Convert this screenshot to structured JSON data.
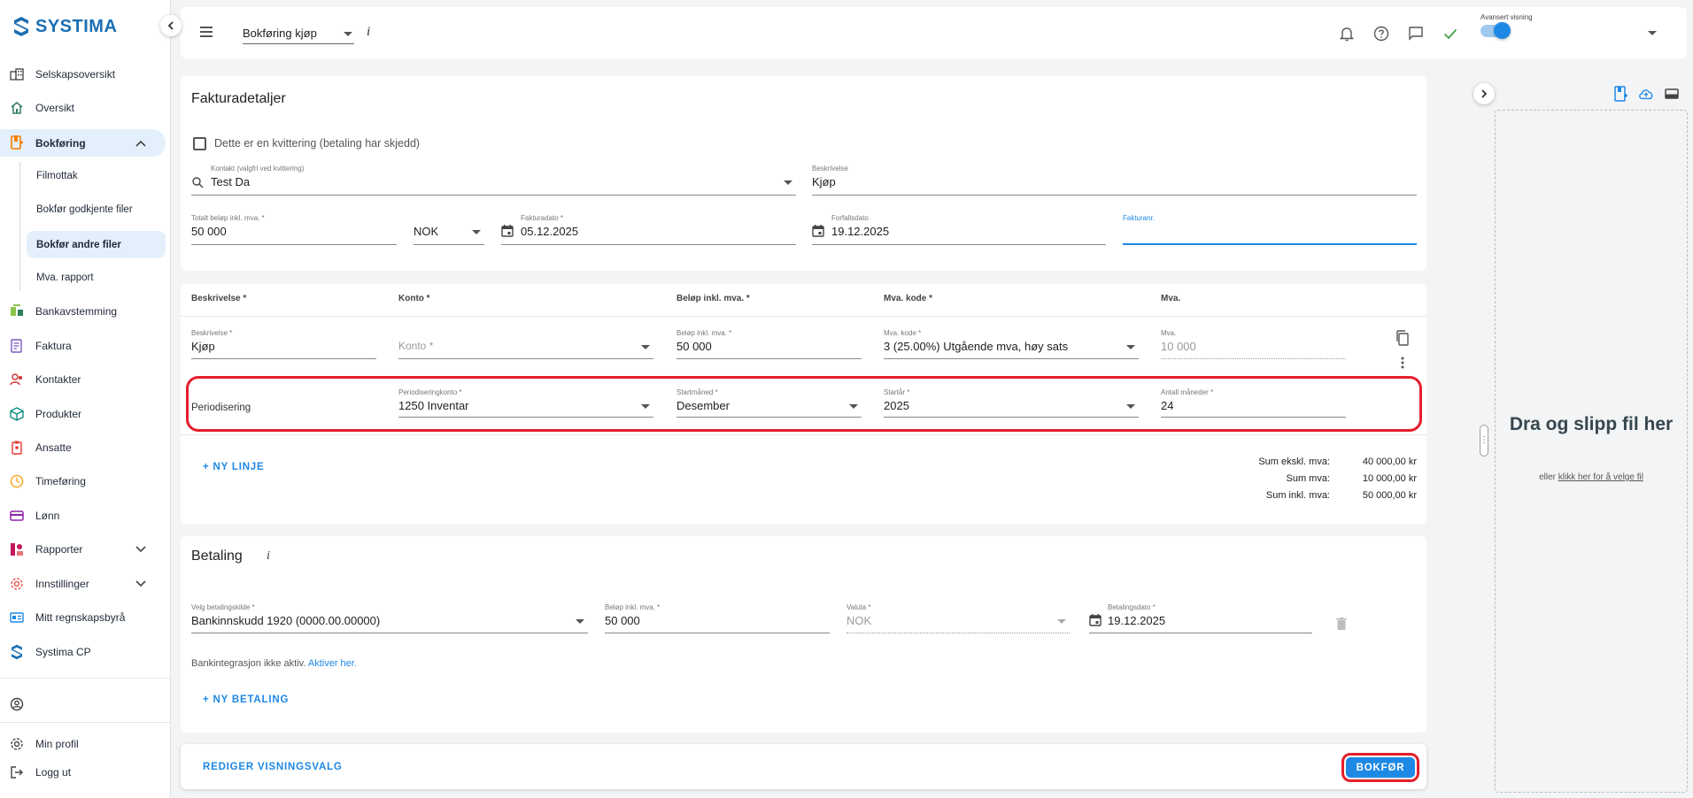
{
  "app": {
    "logo_text": "SYSTIMA"
  },
  "sidebar": {
    "items": [
      {
        "label": "Selskapsoversikt",
        "icon": "company-overview-icon"
      },
      {
        "label": "Oversikt",
        "icon": "home-icon"
      },
      {
        "label": "Bokføring",
        "icon": "bookkeeping-icon"
      },
      {
        "label": "Bankavstemming",
        "icon": "bank-reconciliation-icon"
      },
      {
        "label": "Faktura",
        "icon": "invoice-icon"
      },
      {
        "label": "Kontakter",
        "icon": "contacts-icon"
      },
      {
        "label": "Produkter",
        "icon": "products-icon"
      },
      {
        "label": "Ansatte",
        "icon": "employees-icon"
      },
      {
        "label": "Timeføring",
        "icon": "clock-icon"
      },
      {
        "label": "Lønn",
        "icon": "salary-icon"
      },
      {
        "label": "Rapporter",
        "icon": "reports-icon"
      },
      {
        "label": "Innstillinger",
        "icon": "settings-icon"
      },
      {
        "label": "Mitt regnskapsbyrå",
        "icon": "accounting-firm-icon"
      },
      {
        "label": "Systima CP",
        "icon": "systima-cp-icon"
      }
    ],
    "sub_items": [
      {
        "label": "Filmottak"
      },
      {
        "label": "Bokfør godkjente filer"
      },
      {
        "label": "Bokfør andre filer"
      },
      {
        "label": "Mva. rapport"
      }
    ],
    "bottom": {
      "profile": "Min profil",
      "logout": "Logg ut"
    }
  },
  "topbar": {
    "view_select": "Bokføring kjøp",
    "info": "i",
    "advanced_label": "Avansert visning"
  },
  "invoice": {
    "title": "Fakturadetaljer",
    "receipt_checkbox": "Dette er en kvittering (betaling har skjedd)",
    "contact": {
      "label": "Kontakt (valgfri ved kvittering)",
      "value": "Test Da"
    },
    "description": {
      "label": "Beskrivelse",
      "value": "Kjøp"
    },
    "total": {
      "label": "Totalt beløp inkl. mva. *",
      "value": "50 000"
    },
    "currency": {
      "value": "NOK"
    },
    "invoice_date": {
      "label": "Fakturadato *",
      "value": "05.12.2025"
    },
    "due_date": {
      "label": "Forfallsdato",
      "value": "19.12.2025"
    },
    "invoice_no": {
      "label": "Fakturanr.",
      "value": ""
    }
  },
  "lines": {
    "headers": [
      "Beskrivelse *",
      "Konto *",
      "Beløp inkl. mva. *",
      "Mva. kode *",
      "Mva."
    ],
    "row": {
      "description": {
        "label": "Beskrivelse *",
        "value": "Kjøp"
      },
      "account": {
        "placeholder": "Konto *"
      },
      "amount": {
        "label": "Beløp inkl. mva. *",
        "value": "50 000"
      },
      "vat_code": {
        "label": "Mva. kode *",
        "value": "3 (25.00%) Utgående mva, høy sats"
      },
      "vat": {
        "label": "Mva.",
        "value": "10 000"
      }
    },
    "accrual": {
      "title": "Periodisering",
      "account": {
        "label": "Periodiseringkonto *",
        "value": "1250 Inventar"
      },
      "start_month": {
        "label": "Startmåned *",
        "value": "Desember"
      },
      "start_year": {
        "label": "Startår *",
        "value": "2025"
      },
      "months": {
        "label": "Antall måneder *",
        "value": "24"
      }
    },
    "new_line": "+ NY LINJE",
    "sums": [
      {
        "label": "Sum ekskl. mva:",
        "value": "40 000,00 kr"
      },
      {
        "label": "Sum mva:",
        "value": "10 000,00 kr"
      },
      {
        "label": "Sum inkl. mva:",
        "value": "50 000,00 kr"
      }
    ]
  },
  "payment": {
    "title": "Betaling",
    "info": "i",
    "source": {
      "label": "Velg betalingskilde *",
      "value": "Bankinnskudd 1920 (0000.00.00000)"
    },
    "amount": {
      "label": "Beløp inkl. mva. *",
      "value": "50 000"
    },
    "currency": {
      "label": "Valuta *",
      "value": "NOK"
    },
    "date": {
      "label": "Betalingsdato *",
      "value": "19.12.2025"
    },
    "bank_text": "Bankintegrasjon ikke aktiv.",
    "bank_link": "Aktiver her.",
    "new_payment": "+ NY BETALING"
  },
  "footer": {
    "edit_view": "REDIGER VISNINGSVALG",
    "submit": "BOKFØR"
  },
  "upload": {
    "title": "Dra og slipp fil her",
    "sub_prefix": "eller",
    "sub_link": "klikk her for å velge fil"
  }
}
